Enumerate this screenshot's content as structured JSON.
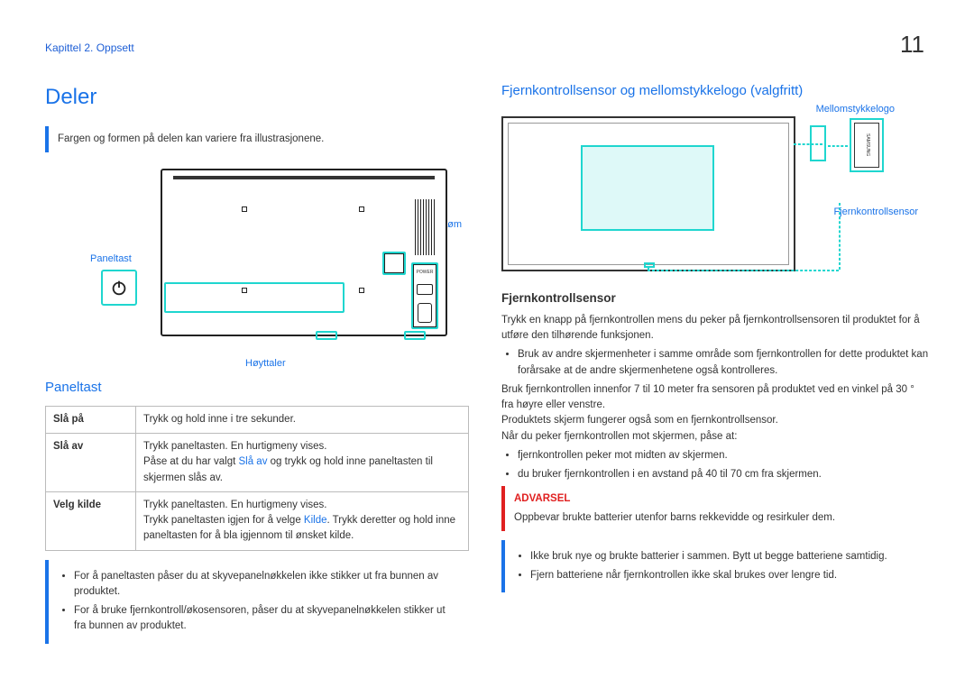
{
  "page_number": "11",
  "chapter": "Kapittel 2. Oppsett",
  "main_heading": "Deler",
  "note_top": "Fargen og formen på delen kan variere fra illustrasjonene.",
  "labels_left": {
    "paneltast": "Paneltast",
    "strom": "Strøm",
    "hoyttaler": "Høyttaler",
    "power_text": "POWER"
  },
  "section_paneltast": "Paneltast",
  "table": {
    "r1h": "Slå på",
    "r1v": "Trykk og hold inne i tre sekunder.",
    "r2h": "Slå av",
    "r2v1": "Trykk paneltasten. En hurtigmeny vises.",
    "r2v2a": "Påse at du har valgt ",
    "r2v2_link": "Slå av",
    "r2v2b": " og trykk og hold inne paneltasten til skjermen slås av.",
    "r3h": "Velg kilde",
    "r3v1": "Trykk paneltasten. En hurtigmeny vises.",
    "r3v2a": "Trykk paneltasten igjen for å velge ",
    "r3v2_link": "Kilde",
    "r3v2b": ". Trykk deretter og hold inne paneltasten for å bla igjennom til ønsket kilde."
  },
  "note_bottom_items": [
    "For å paneltasten påser du at skyvepanelnøkkelen ikke stikker ut fra bunnen av produktet.",
    "For å bruke fjernkontroll/økosensoren, påser du at skyvepanelnøkkelen stikker ut fra bunnen av produktet."
  ],
  "section_right": "Fjernkontrollsensor og mellomstykkelogo (valgfritt)",
  "labels_right": {
    "mellomstykkelogo": "Mellomstykkelogo",
    "fjernkontrollsensor": "Fjernkontrollsensor"
  },
  "sub_fsensor": "Fjernkontrollsensor",
  "sensor_para": "Trykk en knapp på fjernkontrollen mens du peker på fjernkontrollsensoren til produktet for å utføre den tilhørende funksjonen.",
  "sensor_bullet": "Bruk av andre skjermenheter i samme område som fjernkontrollen for dette produktet kan forårsake at de andre skjermenhetene også kontrolleres.",
  "para_range": "Bruk fjernkontrollen innenfor 7 til 10 meter fra sensoren på produktet ved en vinkel på 30 ° fra høyre eller venstre.",
  "para_screen": "Produktets skjerm fungerer også som en fjernkontrollsensor.",
  "para_when": "Når du peker fjernkontrollen mot skjermen, påse at:",
  "when_items": [
    "fjernkontrollen peker mot midten av skjermen.",
    "du bruker fjernkontrollen i en avstand på 40 til 70 cm fra skjermen."
  ],
  "warning_title": "ADVARSEL",
  "warning_text": "Oppbevar brukte batterier utenfor barns rekkevidde og resirkuler dem.",
  "battery_items": [
    "Ikke bruk nye og brukte batterier i sammen. Bytt ut begge batteriene samtidig.",
    "Fjern batteriene når fjernkontrollen ikke skal brukes over lengre tid."
  ]
}
